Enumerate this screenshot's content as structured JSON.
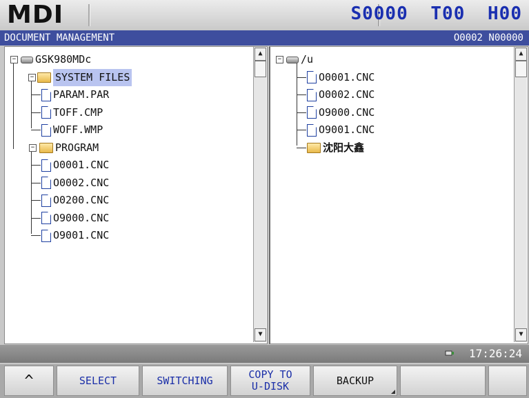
{
  "header": {
    "mode": "MDI",
    "spindle": "S0000",
    "tool": "T00",
    "h_offset": "H00"
  },
  "titlebar": {
    "title": "DOCUMENT MANAGEMENT",
    "program_info": "O0002 N00000"
  },
  "left_tree": {
    "root": "GSK980MDc",
    "system_folder": "SYSTEM FILES",
    "system_files": [
      "PARAM.PAR",
      "TOFF.CMP",
      "WOFF.WMP"
    ],
    "program_folder": "PROGRAM",
    "program_files": [
      "O0001.CNC",
      "O0002.CNC",
      "O0200.CNC",
      "O9000.CNC",
      "O9001.CNC"
    ]
  },
  "right_tree": {
    "root": "/u",
    "files": [
      "O0001.CNC",
      "O0002.CNC",
      "O9000.CNC",
      "O9001.CNC"
    ],
    "folder": "沈阳大鑫"
  },
  "statusbar": {
    "time": "17:26:24"
  },
  "softkeys": {
    "back": "^",
    "select": "SELECT",
    "switching": "SWITCHING",
    "copy_to_udisk": "COPY TO U-DISK",
    "backup": "BACKUP",
    "empty1": "",
    "empty2": ""
  },
  "colors": {
    "title_bg": "#3e4e9e",
    "status_text": "#1a2fb0",
    "selection_bg": "#b9c4f0"
  }
}
